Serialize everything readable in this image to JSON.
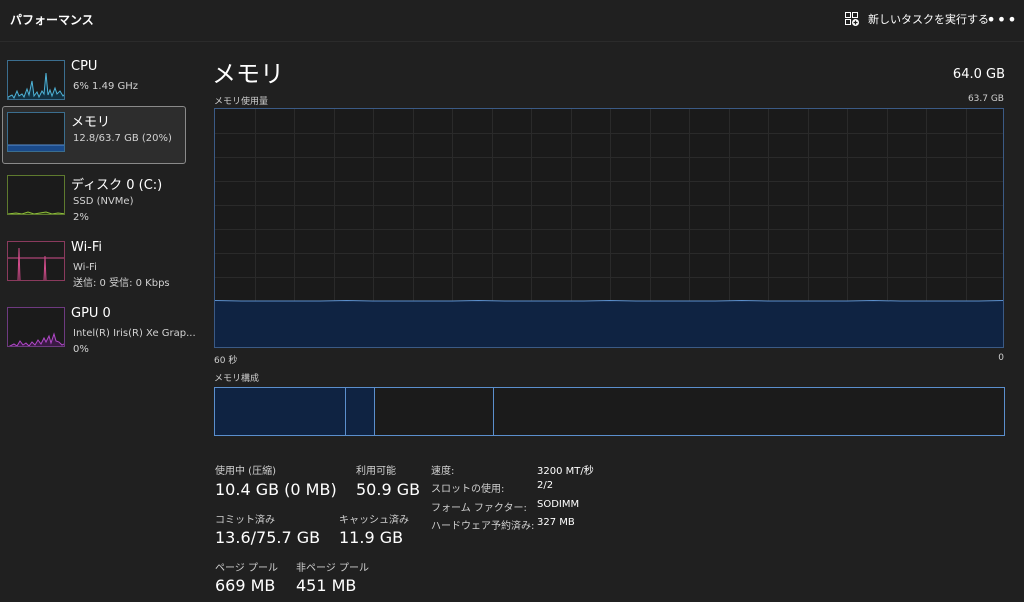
{
  "titlebar": {
    "title": "パフォーマンス",
    "run_task_label": "新しいタスクを実行する",
    "more_label": "•••"
  },
  "sidebar": {
    "items": [
      {
        "name": "CPU",
        "line1": "6%  1.49 GHz",
        "line2": "",
        "line3": "",
        "color": "#4fb4d8",
        "icon": "cpu-graph"
      },
      {
        "name": "メモリ",
        "line1": "12.8/63.7 GB (20%)",
        "line2": "",
        "line3": "",
        "color": "#4b7fd0",
        "icon": "memory-graph"
      },
      {
        "name": "ディスク 0 (C:)",
        "line1": "SSD (NVMe)",
        "line2": "2%",
        "line3": "",
        "color": "#8fbf3a",
        "icon": "disk-graph"
      },
      {
        "name": "Wi-Fi",
        "line1": "Wi-Fi",
        "line2": "送信: 0  受信: 0 Kbps",
        "line3": "",
        "color": "#d24c8b",
        "icon": "wifi-graph"
      },
      {
        "name": "GPU 0",
        "line1": "Intel(R) Iris(R) Xe Grap...",
        "line2": "0%",
        "line3": "",
        "color": "#b248c9",
        "icon": "gpu-graph"
      }
    ]
  },
  "main": {
    "title": "メモリ",
    "total": "64.0 GB",
    "usage_label": "メモリ使用量",
    "usage_max": "63.7 GB",
    "time_left": "60 秒",
    "time_right": "0",
    "composition_label": "メモリ構成",
    "usage_fraction": 0.2
  },
  "stats": {
    "in_use_label": "使用中 (圧縮)",
    "in_use_value": "10.4 GB (0 MB)",
    "available_label": "利用可能",
    "available_value": "50.9 GB",
    "committed_label": "コミット済み",
    "committed_value": "13.6/75.7 GB",
    "cached_label": "キャッシュ済み",
    "cached_value": "11.9 GB",
    "paged_label": "ページ プール",
    "paged_value": "669 MB",
    "nonpaged_label": "非ページ プール",
    "nonpaged_value": "451 MB"
  },
  "specs": {
    "speed_label": "速度:",
    "speed_value": "3200 MT/秒",
    "slots_label": "スロットの使用:",
    "slots_value": "2/2",
    "form_label": "フォーム ファクター:",
    "form_value": "SODIMM",
    "reserved_label": "ハードウェア予約済み:",
    "reserved_value": "327 MB"
  },
  "colors": {
    "memory_line": "#5b8fcd",
    "memory_fill": "#0f2342",
    "grid": "#2a2a2a"
  }
}
